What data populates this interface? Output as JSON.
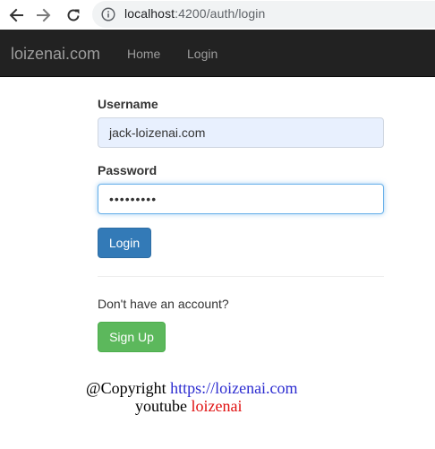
{
  "browser": {
    "url_host": "localhost",
    "url_port_path": ":4200/auth/login",
    "icons": [
      "back-arrow-icon",
      "forward-arrow-icon",
      "reload-icon",
      "info-icon"
    ]
  },
  "navbar": {
    "brand": "loizenai.com",
    "links": [
      "Home",
      "Login"
    ]
  },
  "form": {
    "username_label": "Username",
    "username_value": "jack-loizenai.com",
    "password_label": "Password",
    "password_value": "•••••••••",
    "login_button": "Login",
    "no_account_text": "Don't have an account?",
    "signup_button": "Sign Up"
  },
  "watermark": {
    "line1_prefix": "@Copyright ",
    "line1_link": "https://loizenai.com",
    "line2_prefix": "youtube ",
    "line2_link": "loizenai"
  },
  "colors": {
    "navbar_bg": "#222222",
    "primary": "#337ab7",
    "success": "#5cb85c",
    "autofill_bg": "#e8f0fe",
    "focus_border": "#66afe9"
  }
}
